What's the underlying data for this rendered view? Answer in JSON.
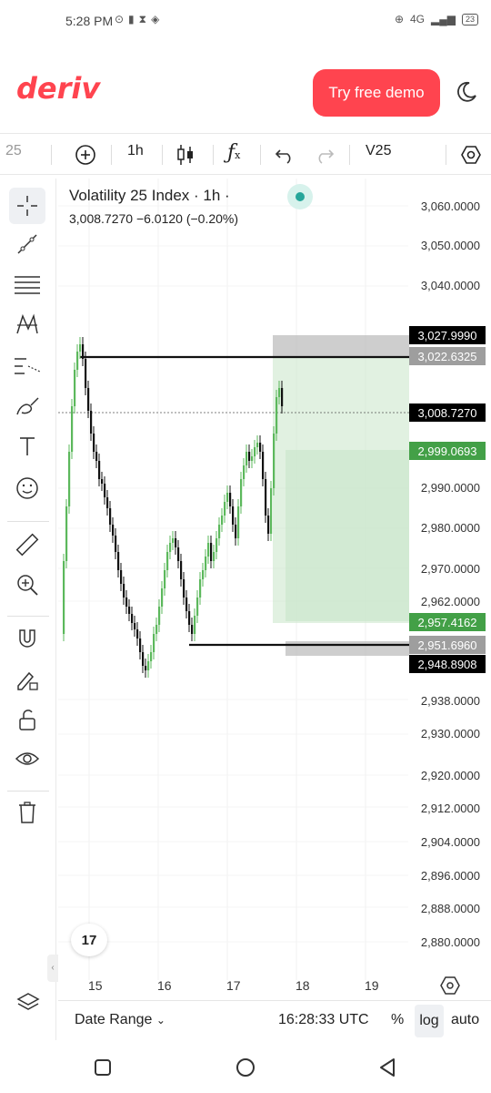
{
  "status": {
    "time": "5:28 PM",
    "battery": "23",
    "signal": "4G"
  },
  "header": {
    "logo": "deriv",
    "cta_label": "Try free demo"
  },
  "toolbar": {
    "symbol_fragment": "25",
    "interval": "1h",
    "symbol": "V25"
  },
  "legend": {
    "title": "Volatility 25 Index · 1h ·",
    "values": "3,008.7270  −6.0120 (−0.20%)"
  },
  "price_axis": {
    "labels": [
      "3,060.0000",
      "3,050.0000",
      "3,040.0000",
      "2,990.0000",
      "2,980.0000",
      "2,970.0000",
      "2,962.0000",
      "2,938.0000",
      "2,930.0000",
      "2,920.0000",
      "2,912.0000",
      "2,904.0000",
      "2,896.0000",
      "2,888.0000",
      "2,880.0000"
    ],
    "tags": [
      {
        "label": "3,027.9990",
        "color": "#000000"
      },
      {
        "label": "3,022.6325",
        "color": "#9e9e9e"
      },
      {
        "label": "3,008.7270",
        "color": "#000000"
      },
      {
        "label": "2,999.0693",
        "color": "#43a047"
      },
      {
        "label": "2,957.4162",
        "color": "#43a047"
      },
      {
        "label": "2,951.6960",
        "color": "#9e9e9e"
      },
      {
        "label": "2,948.8908",
        "color": "#000000"
      }
    ]
  },
  "time_axis": {
    "labels": [
      "15",
      "16",
      "17",
      "18",
      "19"
    ]
  },
  "bottom": {
    "date_range": "Date Range",
    "clock": "16:28:33 UTC",
    "percent": "%",
    "log": "log",
    "auto": "auto"
  },
  "colors": {
    "brand": "#ff444f",
    "up": "#5cb85c",
    "down": "#111111",
    "zone_green": "#c8e6c9",
    "zone_grey": "#bdbdbd",
    "live": "#26a69a"
  }
}
